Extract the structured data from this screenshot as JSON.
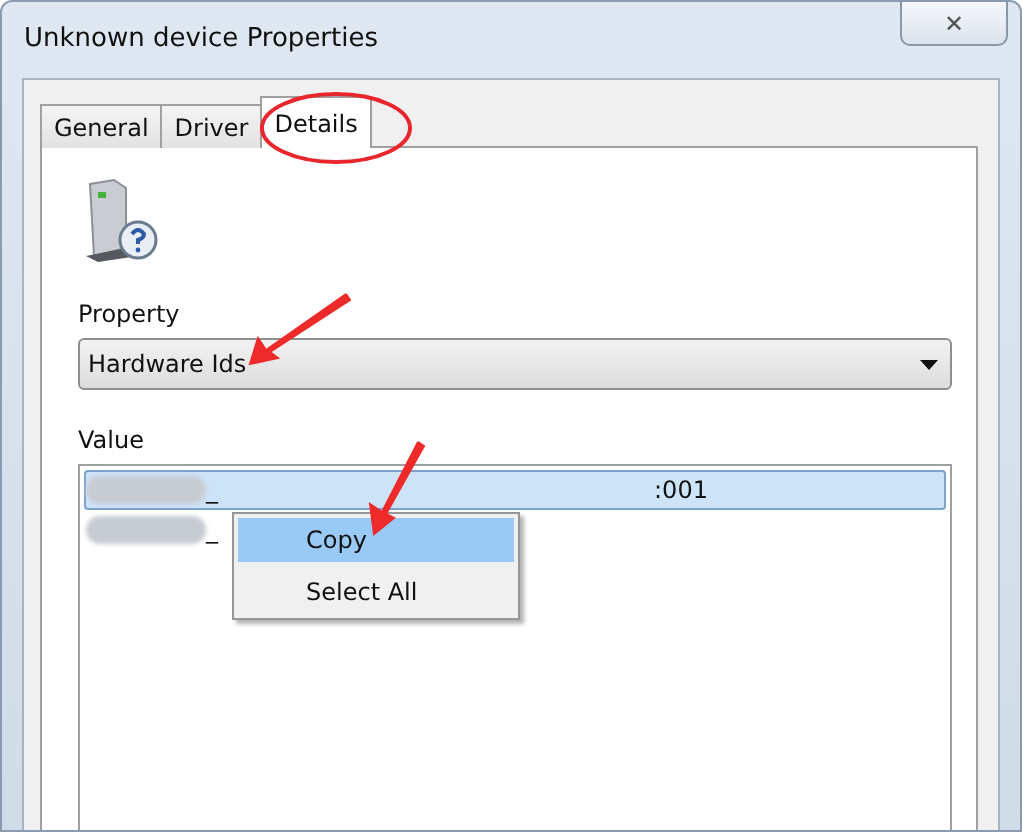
{
  "window": {
    "title": "Unknown device Properties",
    "close": "✕"
  },
  "tabs": [
    {
      "label": "General",
      "selected": false
    },
    {
      "label": "Driver",
      "selected": false
    },
    {
      "label": "Details",
      "selected": true
    }
  ],
  "property": {
    "label": "Property",
    "value": "Hardware Ids"
  },
  "value": {
    "label": "Value",
    "rows": [
      {
        "prefix": "_",
        "tail": ":001",
        "selected": true
      },
      {
        "prefix": "_",
        "tail": "",
        "selected": false
      }
    ]
  },
  "context_menu": [
    {
      "label": "Copy",
      "selected": true
    },
    {
      "label": "Select All",
      "selected": false
    }
  ]
}
